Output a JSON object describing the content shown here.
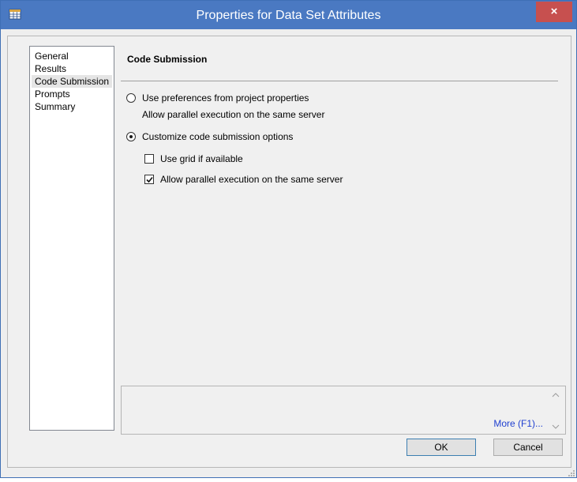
{
  "window": {
    "title": "Properties for Data Set Attributes",
    "close_glyph": "×",
    "app_icon": "data-set-icon"
  },
  "nav": {
    "items": [
      {
        "label": "General",
        "selected": false
      },
      {
        "label": "Results",
        "selected": false
      },
      {
        "label": "Code Submission",
        "selected": true
      },
      {
        "label": "Prompts",
        "selected": false
      },
      {
        "label": "Summary",
        "selected": false
      }
    ]
  },
  "panel": {
    "title": "Code Submission",
    "option_project": {
      "label": "Use preferences from project properties",
      "selected": false,
      "detail": "Allow parallel execution on the same server"
    },
    "option_custom": {
      "label": "Customize code submission options",
      "selected": true
    },
    "use_grid": {
      "label": "Use grid if available",
      "checked": false
    },
    "allow_parallel": {
      "label": "Allow parallel execution on the same server",
      "checked": true
    }
  },
  "help": {
    "more_label": "More (F1)..."
  },
  "buttons": {
    "ok": "OK",
    "cancel": "Cancel"
  },
  "colors": {
    "titlebar": "#4a79c2",
    "close": "#c7504f",
    "link": "#1f3fd0"
  }
}
